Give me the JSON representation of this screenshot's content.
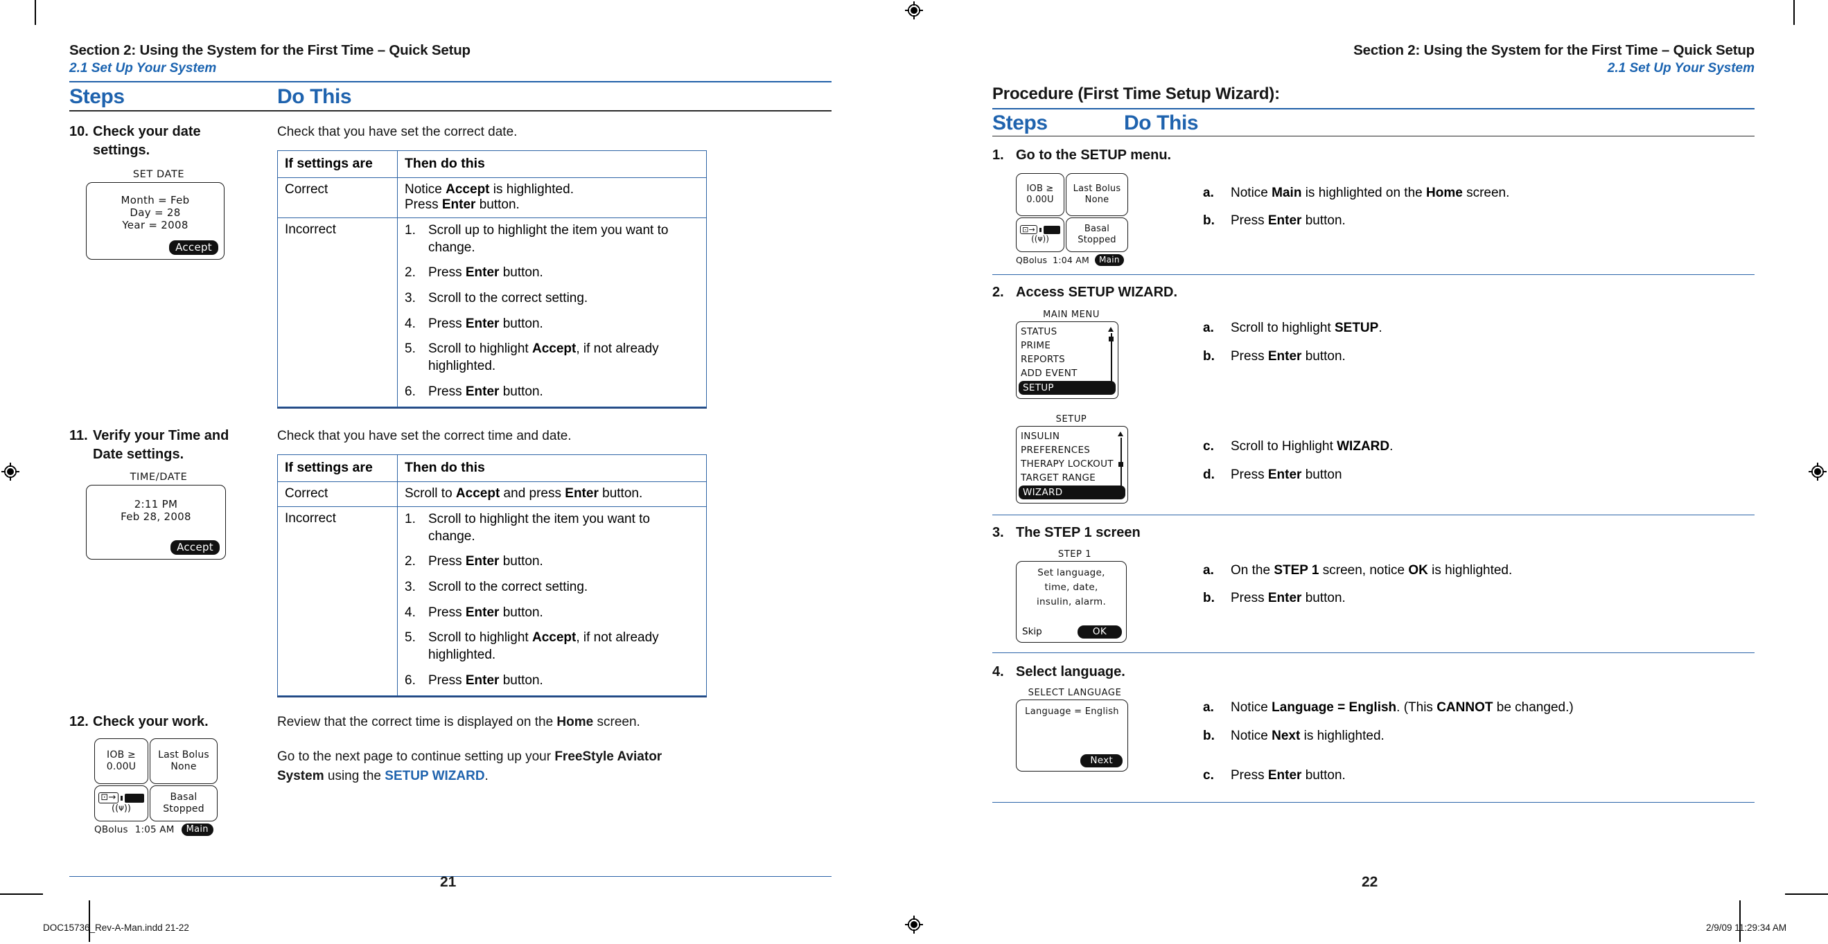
{
  "accent_blue": "#1f63ae",
  "rule_blue": "#2d63a5",
  "ink": "#151515",
  "left_page": {
    "header_line1": "Section 2: Using the System for the First Time – Quick Setup",
    "header_line2": "2.1 Set Up Your System",
    "col_steps": "Steps",
    "col_do_this": "Do This",
    "page_number": "21",
    "steps": [
      {
        "number": "10.",
        "title_line1": "Check your date",
        "title_line2": "settings.",
        "intro": "Check that you have set the correct date.",
        "screen": {
          "caption": "SET DATE",
          "lines": [
            "Month = Feb",
            "Day = 28",
            "Year = 2008"
          ],
          "button": "Accept"
        },
        "table": {
          "head": [
            "If settings are",
            "Then do this"
          ],
          "rows": [
            {
              "key": "Correct",
              "lines": [
                "Notice |Accept| is highlighted.",
                "Press |Enter| button."
              ]
            },
            {
              "key": "Incorrect",
              "items": [
                "Scroll up to highlight the item you want to change.",
                "Press |Enter| button.",
                "Scroll to the correct setting.",
                "Press |Enter| button.",
                "Scroll to highlight |Accept|, if not already highlighted.",
                "Press |Enter| button."
              ]
            }
          ]
        }
      },
      {
        "number": "11.",
        "title_line1": "Verify your Time and",
        "title_line2": "Date settings.",
        "intro": "Check that you have set the correct time and date.",
        "screen": {
          "caption": "TIME/DATE",
          "lines": [
            "2:11 PM",
            "Feb 28, 2008"
          ],
          "button": "Accept"
        },
        "table": {
          "head": [
            "If settings are",
            "Then do this"
          ],
          "rows": [
            {
              "key": "Correct",
              "lines": [
                "Scroll to |Accept| and press |Enter| button."
              ]
            },
            {
              "key": "Incorrect",
              "items": [
                "Scroll to highlight the item you want to change.",
                "Press |Enter| button.",
                "Scroll to the correct setting.",
                "Press |Enter| button.",
                "Scroll to highlight |Accept|, if not already highlighted.",
                "Press |Enter| button."
              ]
            }
          ]
        }
      },
      {
        "number": "12.",
        "title_line1": "Check your work.",
        "para1_a": "Review that the correct time is displayed on the ",
        "para1_bold": "Home",
        "para1_b": " screen.",
        "para2_a": "Go to the next page to continue setting up your ",
        "para2_bold": "FreeStyle Aviator System",
        "para2_b": " using the ",
        "para2_link": "SETUP WIZARD",
        "para2_c": "."
      }
    ],
    "home_screen": {
      "tile_iob_l1": "IOB ≥",
      "tile_iob_l2": "0.00U",
      "tile_bolus_l1": "Last Bolus",
      "tile_bolus_l2": "None",
      "tile_basal": "Basal Stopped",
      "foot_left": "QBolus",
      "foot_time": "1:05 AM",
      "foot_button": "Main"
    },
    "footer_slug": "DOC15736_Rev-A-Man.indd   21-22"
  },
  "right_page": {
    "header_line1": "Section 2: Using the System for the First Time – Quick Setup",
    "header_line2": "2.1 Set Up Your System",
    "procedure_title": "Procedure (First Time Setup Wizard):",
    "col_steps": "Steps",
    "col_do_this": "Do This",
    "page_number": "22",
    "footer_timestamp": "2/9/09   11:29:34 AM",
    "steps": [
      {
        "number": "1.",
        "title": "Go to the SETUP menu.",
        "substeps": [
          {
            "letter": "a.",
            "a": "Notice ",
            "b1": "Main",
            "c": " is highlighted on the ",
            "b2": "Home",
            "d": " screen."
          },
          {
            "letter": "b.",
            "a": "Press ",
            "b1": "Enter",
            "c": " button.",
            "b2": "",
            "d": ""
          }
        ],
        "home_screen": {
          "tile_iob_l1": "IOB ≥",
          "tile_iob_l2": "0.00U",
          "tile_bolus_l1": "Last Bolus",
          "tile_bolus_l2": "None",
          "tile_basal": "Basal Stopped",
          "foot_left": "QBolus",
          "foot_time": "1:04 AM",
          "foot_button": "Main"
        }
      },
      {
        "number": "2.",
        "title": "Access SETUP WIZARD.",
        "substeps_top": [
          {
            "letter": "a.",
            "a": "Scroll to highlight ",
            "b1": "SETUP",
            "c": ".",
            "b2": "",
            "d": ""
          },
          {
            "letter": "b.",
            "a": "Press ",
            "b1": "Enter",
            "c": " button.",
            "b2": "",
            "d": ""
          }
        ],
        "substeps_bottom": [
          {
            "letter": "c.",
            "a": "Scroll to Highlight ",
            "b1": "WIZARD",
            "c": ".",
            "b2": "",
            "d": ""
          },
          {
            "letter": "d.",
            "a": "Press ",
            "b1": "Enter",
            "c": " button",
            "b2": "",
            "d": ""
          }
        ],
        "menu1": {
          "caption": "MAIN MENU",
          "items": [
            "STATUS",
            "PRIME",
            "REPORTS",
            "ADD EVENT",
            "SETUP"
          ],
          "selected": "SETUP"
        },
        "menu2": {
          "caption": "SETUP",
          "items": [
            "INSULIN",
            "PREFERENCES",
            "THERAPY LOCKOUT",
            "TARGET RANGE",
            "WIZARD"
          ],
          "selected": "WIZARD"
        }
      },
      {
        "number": "3.",
        "title": "The STEP 1 screen",
        "substeps": [
          {
            "letter": "a.",
            "a": "On the ",
            "b1": "STEP 1",
            "c": " screen, notice ",
            "b2": "OK",
            "d": " is highlighted."
          },
          {
            "letter": "b.",
            "a": "Press ",
            "b1": "Enter",
            "c": " button.",
            "b2": "",
            "d": ""
          }
        ],
        "screen": {
          "caption": "STEP 1",
          "lines": [
            "Set language,",
            "time, date,",
            "insulin, alarm."
          ],
          "skip": "Skip",
          "ok": "OK"
        }
      },
      {
        "number": "4.",
        "title": "Select language.",
        "substeps": [
          {
            "letter": "a.",
            "a": "Notice ",
            "b1": "Language = English",
            "c": ". (This ",
            "b2": "CANNOT",
            "d": " be changed.)"
          },
          {
            "letter": "b.",
            "a": "Notice ",
            "b1": "Next",
            "c": " is highlighted.",
            "b2": "",
            "d": ""
          },
          {
            "letter": "c.",
            "a": "Press ",
            "b1": "Enter",
            "c": " button.",
            "b2": "",
            "d": ""
          }
        ],
        "screen": {
          "caption": "SELECT LANGUAGE",
          "line": "Language = English",
          "button": "Next"
        }
      }
    ]
  }
}
